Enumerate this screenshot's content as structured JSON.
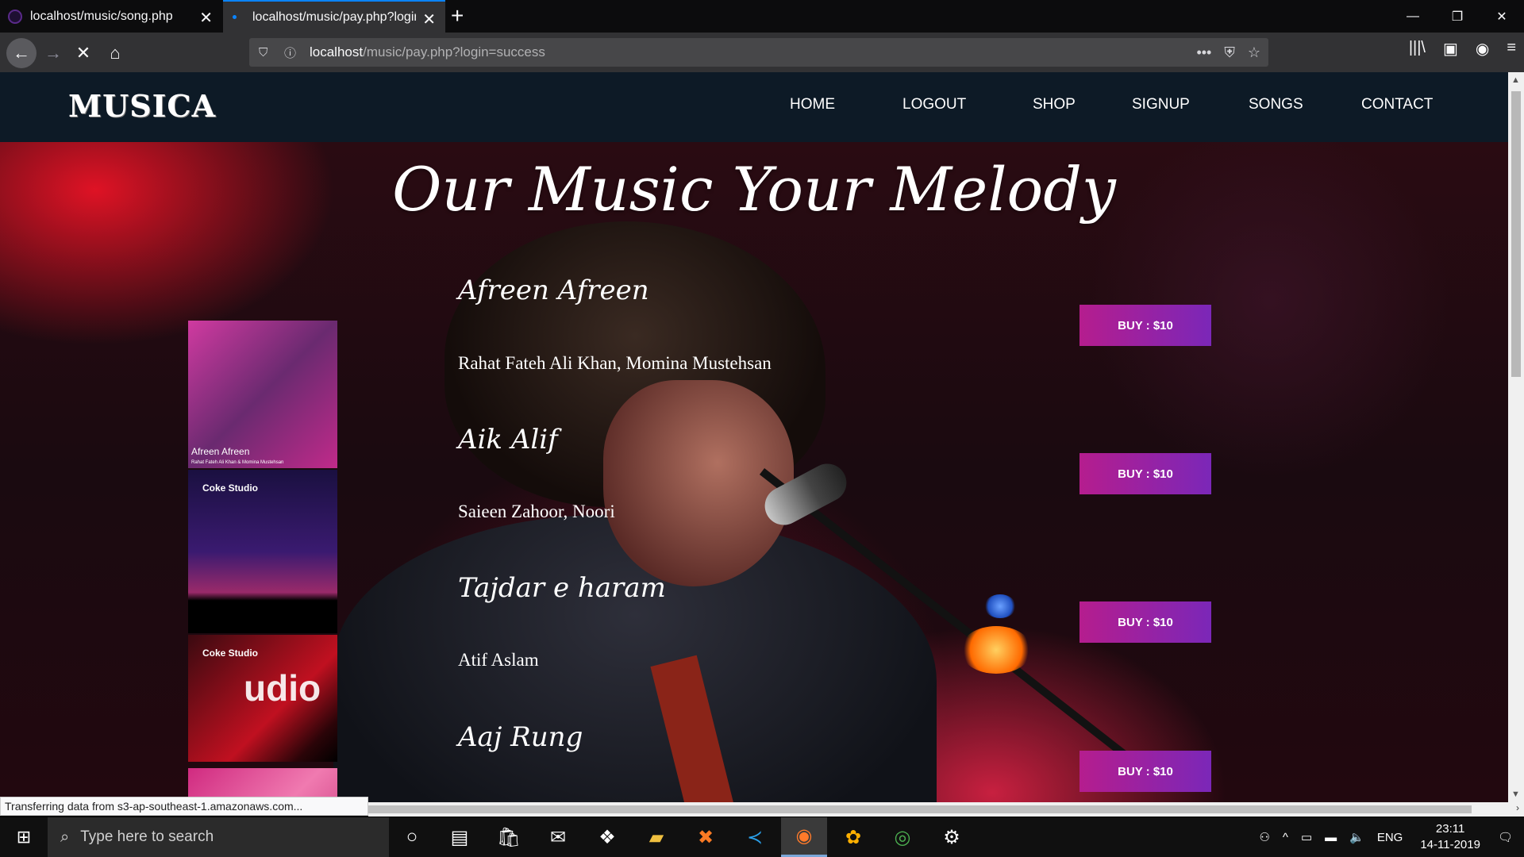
{
  "browser": {
    "tabs": [
      {
        "title": "localhost/music/song.php",
        "active": false
      },
      {
        "title": "localhost/music/pay.php?login=success",
        "active": true
      }
    ],
    "url_host": "localhost",
    "url_path": "/music/pay.php?login=success",
    "status_text": "Transferring data from s3-ap-southeast-1.amazonaws.com...",
    "icons": [
      "back-icon",
      "forward-icon",
      "stop-icon",
      "home-icon",
      "shield-icon",
      "info-icon",
      "more-icon",
      "pocket-icon",
      "star-icon",
      "library-icon",
      "sidebar-icon",
      "account-icon",
      "menu-icon"
    ]
  },
  "site": {
    "logo": "MUSICA",
    "nav": [
      "HOME",
      "LOGOUT",
      "SHOP",
      "SIGNUP",
      "SONGS",
      "CONTACT"
    ],
    "hero_title": "Our Music Your Melody",
    "accent_gradient": [
      "#b51d8e",
      "#7b27b8"
    ],
    "header_bg": "#0d1a26"
  },
  "songs": [
    {
      "title": "Afreen Afreen",
      "artist": "Rahat Fateh Ali Khan, Momina Mustehsan",
      "buy": "BUY : $10"
    },
    {
      "title": "Aik Alif",
      "artist": "Saieen Zahoor, Noori",
      "buy": "BUY : $10"
    },
    {
      "title": "Tajdar e haram",
      "artist": "Atif Aslam",
      "buy": "BUY : $10"
    },
    {
      "title": "Aaj Rung",
      "artist": "",
      "buy": "BUY : $10"
    }
  ],
  "thumbnails": {
    "t1_caption": "Afreen Afreen",
    "t1_sub": "Rahat Fateh Ali Khan & Momina Mustehsan",
    "t2_studio": "Coke Studio",
    "t3_studio": "Coke Studio",
    "t3_big": "udio"
  },
  "taskbar": {
    "search_placeholder": "Type here to search",
    "lang": "ENG",
    "time": "23:11",
    "date": "14-11-2019"
  }
}
